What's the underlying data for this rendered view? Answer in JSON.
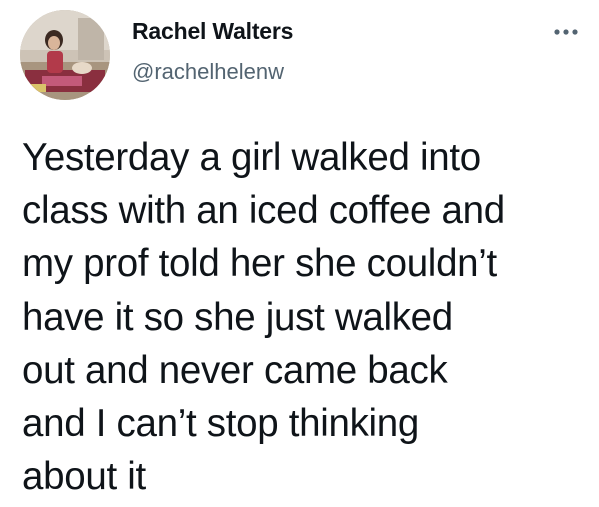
{
  "tweet": {
    "author": {
      "display_name": "Rachel Walters",
      "handle": "@rachelhelenw",
      "avatar_icon": "profile-photo-avatar"
    },
    "more_icon": "more-options-icon",
    "text": "Yesterday a girl walked into\nclass with an iced coffee and\nmy prof told her she couldn’t\nhave it so she just walked\nout and never came back\nand I can’t stop thinking\nabout it"
  },
  "colors": {
    "text_primary": "#0f1419",
    "text_secondary": "#536471",
    "background": "#ffffff"
  }
}
